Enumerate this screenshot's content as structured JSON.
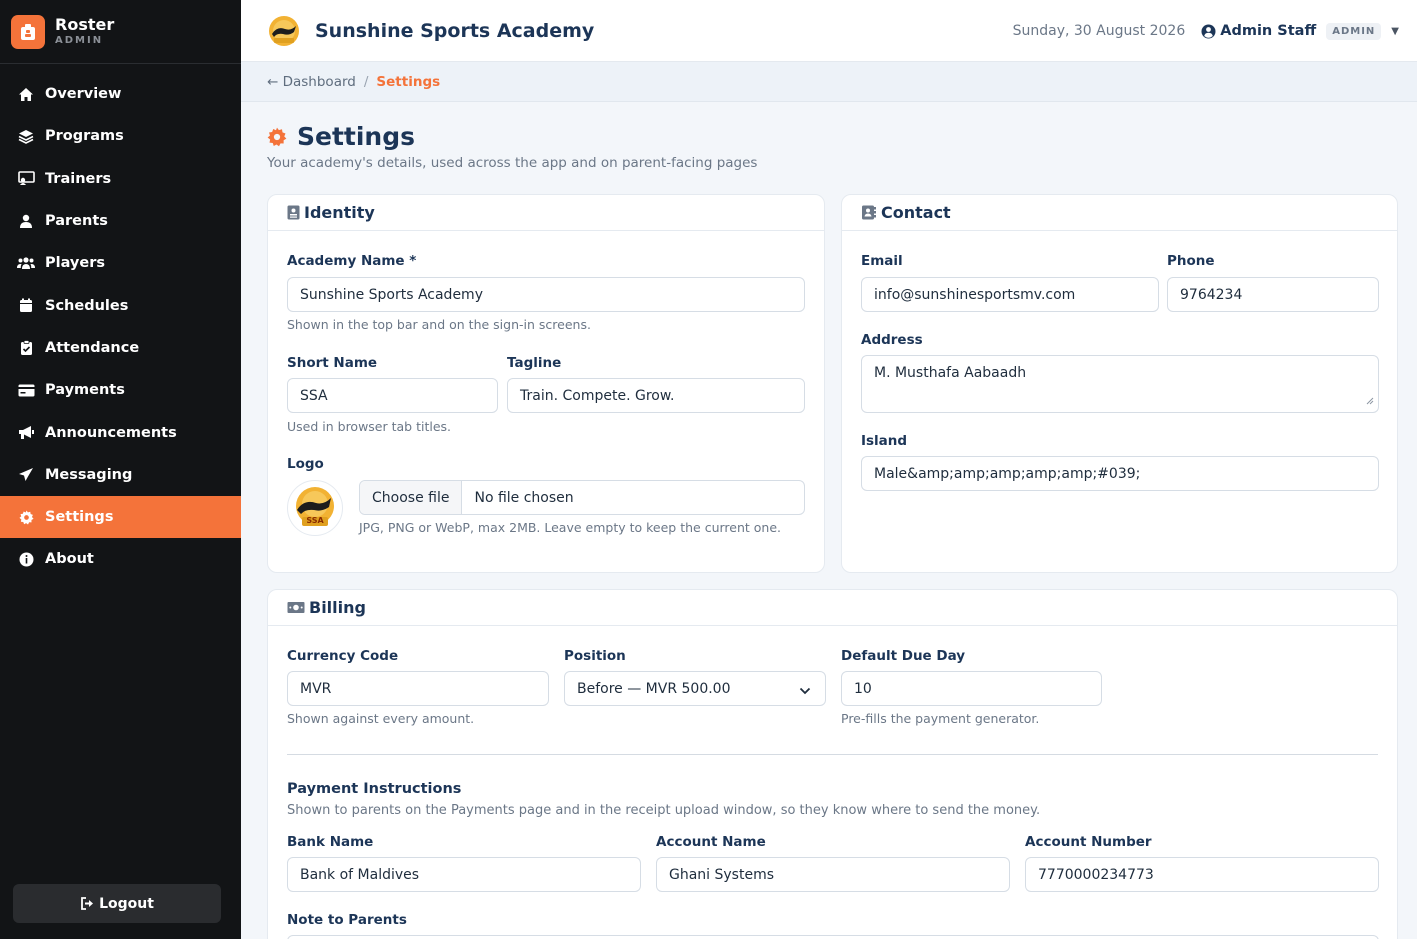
{
  "sidebar": {
    "brand_title": "Roster",
    "brand_sub": "ADMIN",
    "items": [
      {
        "label": "Overview",
        "icon": "home-icon"
      },
      {
        "label": "Programs",
        "icon": "layers-icon"
      },
      {
        "label": "Trainers",
        "icon": "whistle-icon"
      },
      {
        "label": "Parents",
        "icon": "user-icon"
      },
      {
        "label": "Players",
        "icon": "users-icon"
      },
      {
        "label": "Schedules",
        "icon": "calendar-icon"
      },
      {
        "label": "Attendance",
        "icon": "clipboard-check-icon"
      },
      {
        "label": "Payments",
        "icon": "credit-card-icon"
      },
      {
        "label": "Announcements",
        "icon": "bullhorn-icon"
      },
      {
        "label": "Messaging",
        "icon": "paper-plane-icon"
      },
      {
        "label": "Settings",
        "icon": "gear-icon"
      },
      {
        "label": "About",
        "icon": "info-icon"
      }
    ],
    "active": "Settings",
    "logout_label": "Logout"
  },
  "topbar": {
    "title": "Sunshine Sports Academy",
    "date": "Sunday, 30 August 2026",
    "user_name": "Admin Staff",
    "role_badge": "ADMIN"
  },
  "breadcrumb": {
    "back": "← Dashboard",
    "sep": "/",
    "current": "Settings"
  },
  "page": {
    "title": "Settings",
    "subtitle": "Your academy's details, used across the app and on parent-facing pages"
  },
  "identity": {
    "heading": "Identity",
    "academy_name_label": "Academy Name *",
    "academy_name_value": "Sunshine Sports Academy",
    "academy_name_help": "Shown in the top bar and on the sign-in screens.",
    "short_name_label": "Short Name",
    "short_name_value": "SSA",
    "tagline_label": "Tagline",
    "tagline_value": "Train. Compete. Grow.",
    "short_name_help": "Used in browser tab titles.",
    "logo_label": "Logo",
    "logo_text": "SSA",
    "file_button": "Choose file",
    "file_status": "No file chosen",
    "logo_help": "JPG, PNG or WebP, max 2MB. Leave empty to keep the current one."
  },
  "contact": {
    "heading": "Contact",
    "email_label": "Email",
    "email_value": "info@sunshinesportsmv.com",
    "phone_label": "Phone",
    "phone_value": "9764234",
    "address_label": "Address",
    "address_value": "M. Musthafa Aabaadh",
    "island_label": "Island",
    "island_value": "Male&amp;amp;amp;amp;amp;#039;"
  },
  "billing": {
    "heading": "Billing",
    "currency_label": "Currency Code",
    "currency_value": "MVR",
    "currency_help": "Shown against every amount.",
    "position_label": "Position",
    "position_value": "Before — MVR 500.00",
    "due_label": "Default Due Day",
    "due_value": "10",
    "due_help": "Pre-fills the payment generator.",
    "instructions_title": "Payment Instructions",
    "instructions_help": "Shown to parents on the Payments page and in the receipt upload window, so they know where to send the money.",
    "bank_label": "Bank Name",
    "bank_value": "Bank of Maldives",
    "account_name_label": "Account Name",
    "account_name_value": "Ghani Systems",
    "account_number_label": "Account Number",
    "account_number_value": "7770000234773",
    "note_label": "Note to Parents"
  },
  "colors": {
    "accent": "#f4733a",
    "sidebar_bg": "#121416",
    "heading": "#1c3557"
  }
}
